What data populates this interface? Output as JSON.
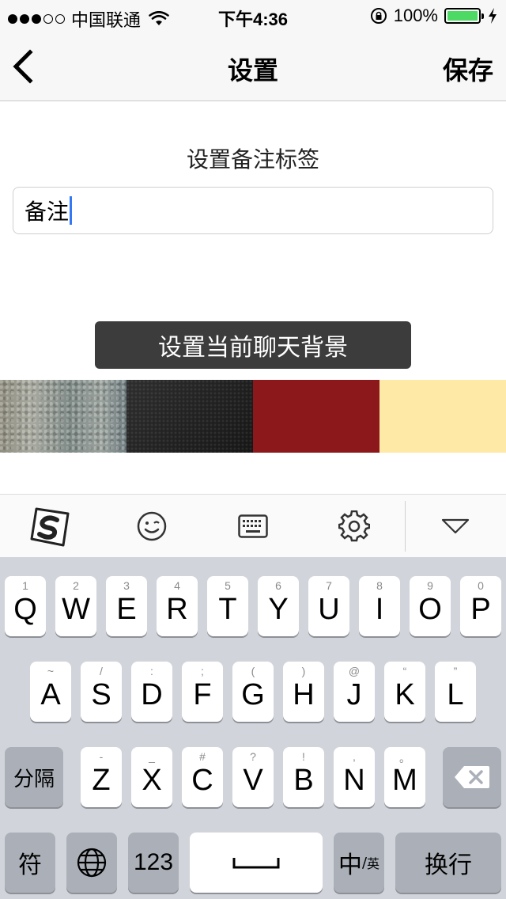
{
  "status_bar": {
    "carrier": "中国联通",
    "time": "下午4:36",
    "battery": "100%",
    "signal_strength": 3,
    "battery_color": "#4cd964"
  },
  "nav": {
    "title": "设置",
    "save_label": "保存"
  },
  "content": {
    "section_title": "设置备注标签",
    "remark_value": "备注",
    "set_bg_label": "设置当前聊天背景"
  },
  "swatches": [
    {
      "name": "gray-texture"
    },
    {
      "name": "black-texture"
    },
    {
      "name": "dark-red",
      "color": "#8d181b"
    },
    {
      "name": "light-yellow",
      "color": "#ffe9a6"
    }
  ],
  "ime_toolbar": {
    "icons": [
      "sogou-logo-icon",
      "emoji-icon",
      "keyboard-icon",
      "gear-icon",
      "chevron-down-icon"
    ]
  },
  "keyboard": {
    "row1": [
      {
        "key": "Q",
        "sub": "1"
      },
      {
        "key": "W",
        "sub": "2"
      },
      {
        "key": "E",
        "sub": "3"
      },
      {
        "key": "R",
        "sub": "4"
      },
      {
        "key": "T",
        "sub": "5"
      },
      {
        "key": "Y",
        "sub": "6"
      },
      {
        "key": "U",
        "sub": "7"
      },
      {
        "key": "I",
        "sub": "8"
      },
      {
        "key": "O",
        "sub": "9"
      },
      {
        "key": "P",
        "sub": "0"
      }
    ],
    "row2": [
      {
        "key": "A",
        "sub": "~"
      },
      {
        "key": "S",
        "sub": "/"
      },
      {
        "key": "D",
        "sub": ":"
      },
      {
        "key": "F",
        "sub": ";"
      },
      {
        "key": "G",
        "sub": "("
      },
      {
        "key": "H",
        "sub": ")"
      },
      {
        "key": "J",
        "sub": "@"
      },
      {
        "key": "K",
        "sub": "“"
      },
      {
        "key": "L",
        "sub": "”"
      }
    ],
    "row3": [
      {
        "key": "Z",
        "sub": "-"
      },
      {
        "key": "X",
        "sub": "_"
      },
      {
        "key": "C",
        "sub": "#"
      },
      {
        "key": "V",
        "sub": "?"
      },
      {
        "key": "B",
        "sub": "!"
      },
      {
        "key": "N",
        "sub": ","
      },
      {
        "key": "M",
        "sub": "。"
      }
    ],
    "separator_label": "分隔",
    "symbol_label": "符",
    "number_label": "123",
    "lang_main": "中",
    "lang_sep": "/",
    "lang_sub": "英",
    "return_label": "换行"
  }
}
